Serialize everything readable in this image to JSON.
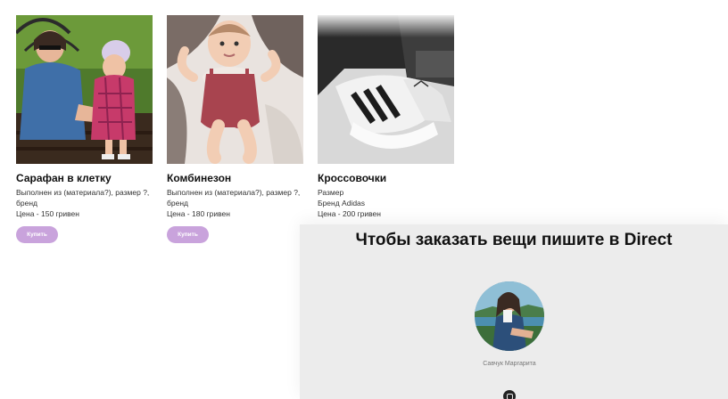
{
  "top_faded_text": "",
  "products": [
    {
      "title": "Сарафан в клетку",
      "desc": "Выполнен из (материала?), размер ?,\nбренд\nЦена - 150 гривен",
      "buy_label": "Купить"
    },
    {
      "title": "Комбинезон",
      "desc": "Выполнен из (материала?), размер ?,\nбренд\nЦена - 180 гривен",
      "buy_label": "Купить"
    },
    {
      "title": "Кроссовочки",
      "desc": "Размер\nБренд Adidas\nЦена - 200 гривен",
      "buy_label": null
    }
  ],
  "contact": {
    "heading": "Чтобы заказать вещи пишите в Direct",
    "name": "Савчук Маргарита",
    "icon": "instagram-icon"
  },
  "colors": {
    "buy_button": "#c9a3dc",
    "panel_bg": "#ececec"
  }
}
